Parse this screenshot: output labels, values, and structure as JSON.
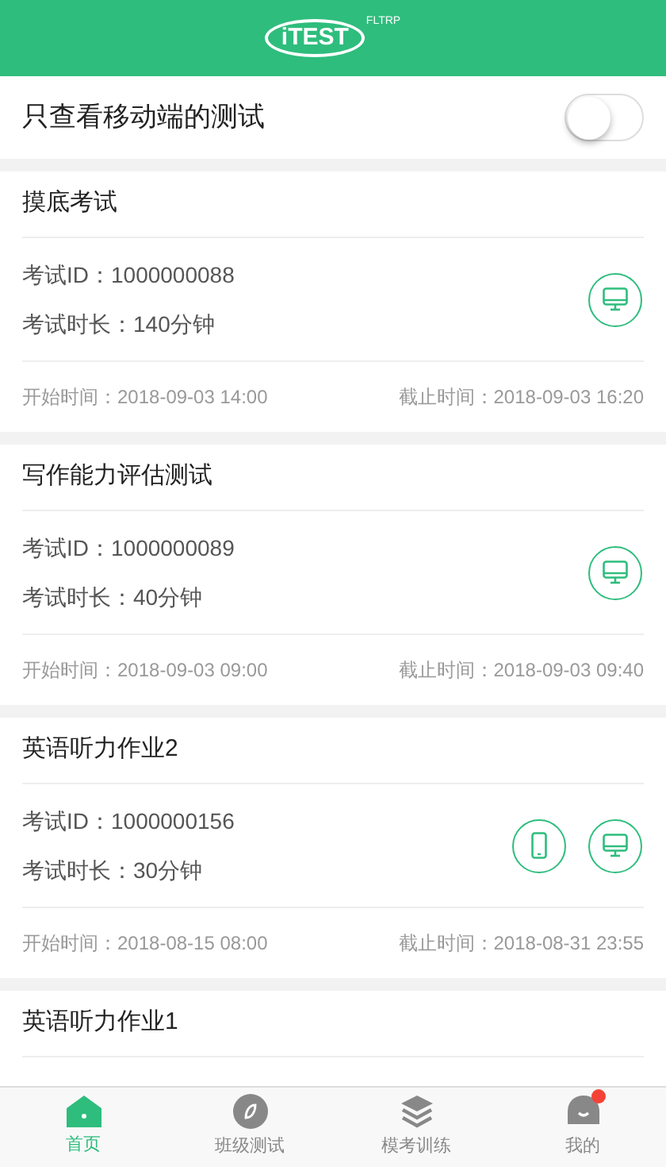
{
  "header": {
    "logo": {
      "main": "iTEST",
      "small": "FLTRP"
    }
  },
  "filter": {
    "label": "只查看移动端的测试",
    "on": false
  },
  "exams": [
    {
      "title": "摸底考试",
      "id_line": "考试ID：1000000088",
      "duration": "考试时长：140分钟",
      "devices": [
        {
          "kind": "pc"
        }
      ],
      "start": "开始时间：2018-09-03 14:00",
      "end": "截止时间：2018-09-03 16:20"
    },
    {
      "title": "写作能力评估测试",
      "id_line": "考试ID：1000000089",
      "duration": "考试时长：40分钟",
      "devices": [
        {
          "kind": "pc"
        }
      ],
      "start": "开始时间：2018-09-03 09:00",
      "end": "截止时间：2018-09-03 09:40"
    },
    {
      "title": "英语听力作业2",
      "id_line": "考试ID：1000000156",
      "duration": "考试时长：30分钟",
      "devices": [
        {
          "kind": "mobile"
        },
        {
          "kind": "pc"
        }
      ],
      "start": "开始时间：2018-08-15 08:00",
      "end": "截止时间：2018-08-31 23:55"
    },
    {
      "title": "英语听力作业1"
    }
  ],
  "tabs": [
    {
      "label": "首页",
      "kind": "home",
      "selected": true,
      "badge": false
    },
    {
      "label": "班级测试",
      "kind": "compass",
      "selected": false,
      "badge": false
    },
    {
      "label": "模考训练",
      "kind": "layers",
      "selected": false,
      "badge": false
    },
    {
      "label": "我的",
      "kind": "me",
      "selected": false,
      "badge": true
    }
  ]
}
